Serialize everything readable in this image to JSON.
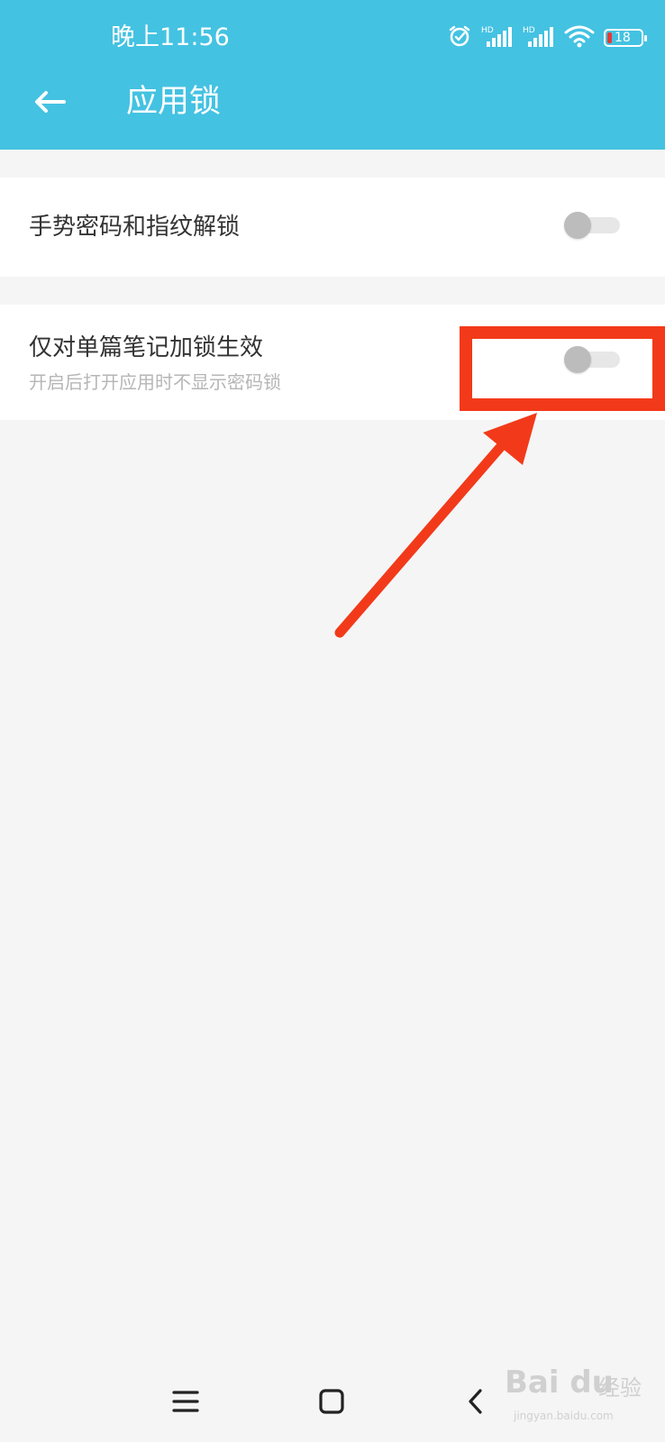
{
  "status_bar": {
    "time": "晚上11:56",
    "icons": [
      "alarm-icon",
      "signal-hd-icon",
      "signal-hd-icon",
      "wifi-icon",
      "battery-icon"
    ],
    "hd_label": "HD",
    "battery_level": "18"
  },
  "header": {
    "title": "应用锁",
    "back_icon": "arrow-left-icon",
    "background": "#44c2e2"
  },
  "settings": {
    "items": [
      {
        "title": "手势密码和指纹解锁",
        "enabled": false
      },
      {
        "title": "仅对单篇笔记加锁生效",
        "subtitle": "开启后打开应用时不显示密码锁",
        "enabled": false
      }
    ]
  },
  "annotation": {
    "highlight_color": "#f23a1a",
    "icons": [
      "highlight-box",
      "pointer-arrow"
    ]
  },
  "navigation": {
    "buttons": [
      "menu-icon",
      "home-icon",
      "back-chevron-icon"
    ]
  },
  "watermark": {
    "brand": "Bai du",
    "suffix": "经验",
    "url": "jingyan.baidu.com"
  }
}
